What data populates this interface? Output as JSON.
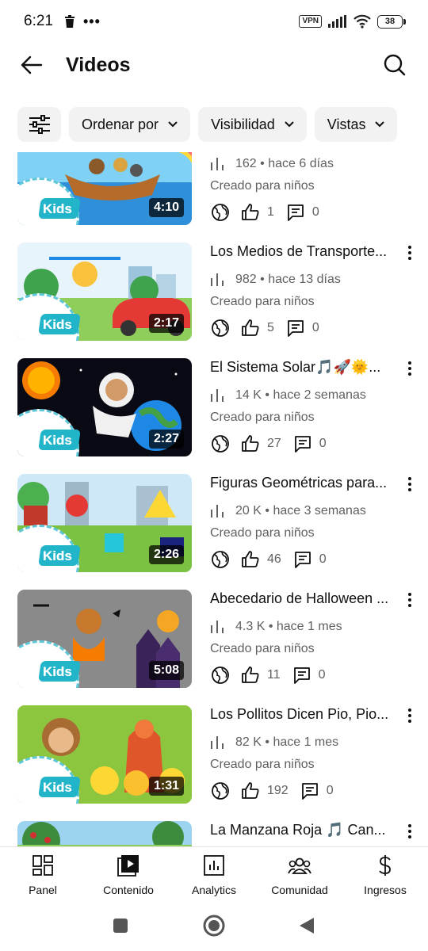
{
  "status_bar": {
    "time": "6:21",
    "dots": "•••",
    "vpn": "VPN",
    "battery": "38"
  },
  "header": {
    "title": "Videos"
  },
  "chips": [
    {
      "label": "Ordenar por"
    },
    {
      "label": "Visibilidad"
    },
    {
      "label": "Vistas"
    }
  ],
  "kids_logo_text": "Kids",
  "videos": [
    {
      "title": "",
      "views": "162",
      "age": "hace 6 días",
      "audience": "Creado para niños",
      "likes": "1",
      "comments": "0",
      "duration": "4:10"
    },
    {
      "title": "Los Medios de Transporte...",
      "views": "982",
      "age": "hace 13 días",
      "audience": "Creado para niños",
      "likes": "5",
      "comments": "0",
      "duration": "2:17"
    },
    {
      "title": "El Sistema Solar🎵🚀🌞...",
      "views": "14 K",
      "age": "hace 2 semanas",
      "audience": "Creado para niños",
      "likes": "27",
      "comments": "0",
      "duration": "2:27"
    },
    {
      "title": "Figuras Geométricas para...",
      "views": "20 K",
      "age": "hace 3 semanas",
      "audience": "Creado para niños",
      "likes": "46",
      "comments": "0",
      "duration": "2:26"
    },
    {
      "title": "Abecedario de Halloween ...",
      "views": "4.3 K",
      "age": "hace 1 mes",
      "audience": "Creado para niños",
      "likes": "11",
      "comments": "0",
      "duration": "5:08"
    },
    {
      "title": "Los Pollitos Dicen Pio, Pio...",
      "views": "82 K",
      "age": "hace 1 mes",
      "audience": "Creado para niños",
      "likes": "192",
      "comments": "0",
      "duration": "1:31"
    },
    {
      "title": "La Manzana Roja 🎵 Can...",
      "views": "",
      "age": "",
      "audience": "",
      "likes": "",
      "comments": "",
      "duration": ""
    }
  ],
  "meta_separator": "•",
  "bottom_nav": [
    {
      "label": "Panel",
      "icon": "dashboard-icon"
    },
    {
      "label": "Contenido",
      "icon": "content-icon"
    },
    {
      "label": "Analytics",
      "icon": "analytics-icon"
    },
    {
      "label": "Comunidad",
      "icon": "community-icon"
    },
    {
      "label": "Ingresos",
      "icon": "earn-icon"
    }
  ],
  "colors": {
    "accent_text": "#0f0f0f",
    "secondary_text": "#606060",
    "chip_bg": "#f2f2f2",
    "kids_teal": "#22b5c9"
  }
}
